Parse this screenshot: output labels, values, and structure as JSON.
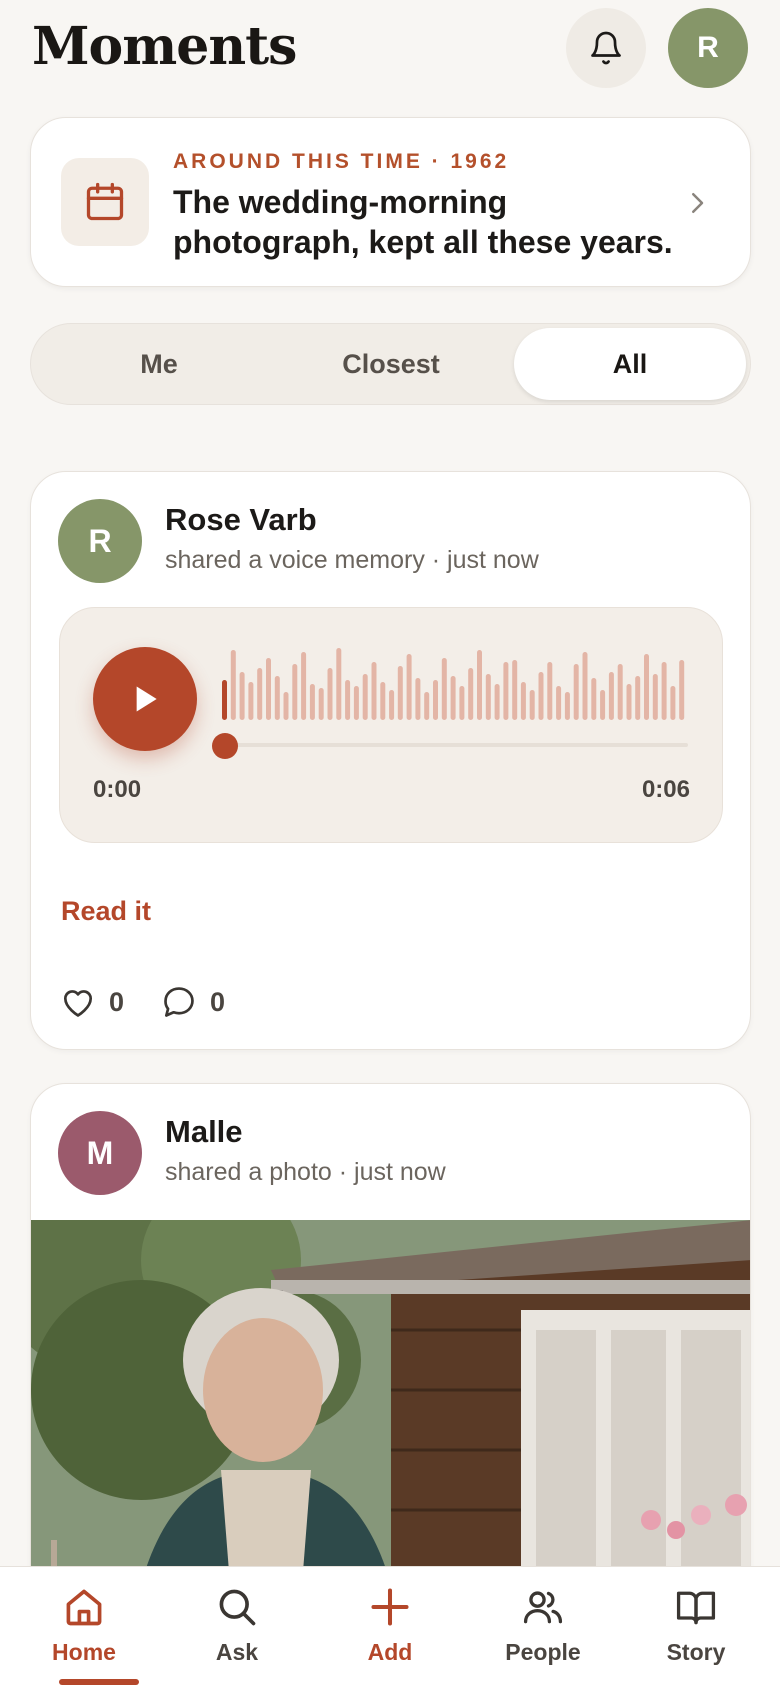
{
  "header": {
    "title": "Moments",
    "avatar_initial": "R",
    "avatar_color": "#869669"
  },
  "memory_prompt": {
    "eyebrow": "AROUND THIS TIME · 1962",
    "text": "The wedding-morning photograph, kept all these years."
  },
  "filters": {
    "tabs": [
      "Me",
      "Closest",
      "All"
    ],
    "selected": "All"
  },
  "posts": [
    {
      "initial": "R",
      "avatar_color": "#869669",
      "name": "Rose Varb",
      "meta": "shared a voice memory · just now",
      "audio": {
        "current": "0:00",
        "duration": "0:06",
        "progress": 0
      },
      "read_link": "Read it",
      "likes": "0",
      "comments": "0"
    },
    {
      "initial": "M",
      "avatar_color": "#9b5a6c",
      "name": "Malle",
      "meta": "shared a photo · just now"
    }
  ],
  "nav": {
    "items": [
      "Home",
      "Ask",
      "Add",
      "People",
      "Story"
    ],
    "active": "Home"
  },
  "colors": {
    "accent": "#b4472a",
    "background": "#f8f6f3"
  }
}
